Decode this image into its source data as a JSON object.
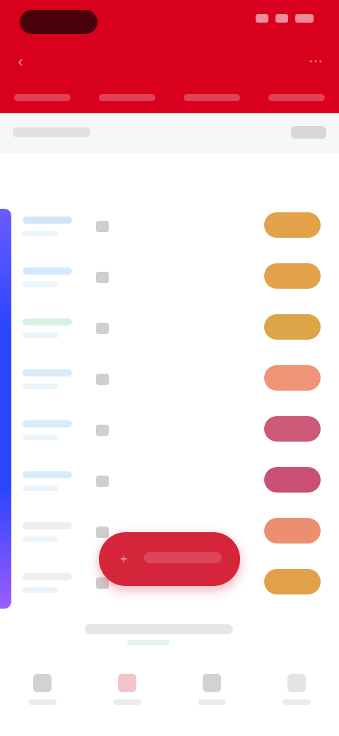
{
  "header": {
    "title": "",
    "back_icon": "chevron-left-icon",
    "more_icon": "more-icon",
    "tabs": [
      "",
      "",
      "",
      ""
    ]
  },
  "section": {
    "title": ""
  },
  "rows": [
    {
      "name_color": "#cfe6f7",
      "pill_color": "#e2a24a",
      "value": ""
    },
    {
      "name_color": "#d2e9ff",
      "pill_color": "#e2a24a",
      "value": ""
    },
    {
      "name_color": "#d7f0e3",
      "pill_color": "#dca548",
      "value": ""
    },
    {
      "name_color": "#d6ecfa",
      "pill_color": "#ee9478",
      "value": ""
    },
    {
      "name_color": "#d6ecfa",
      "pill_color": "#cc5a78",
      "value": ""
    },
    {
      "name_color": "#d6ecfa",
      "pill_color": "#c95074",
      "value": ""
    },
    {
      "name_color": "#eeeeee",
      "pill_color": "#ea8f6f",
      "value": ""
    },
    {
      "name_color": "#eeeeee",
      "pill_color": "#e2a04a",
      "value": ""
    }
  ],
  "fab": {
    "label": "",
    "icon": "plus-icon",
    "color": "#d5253a"
  },
  "colors": {
    "header": "#d9001e",
    "accent": "#d5253a"
  },
  "tabbar": [
    {
      "icon": "home-icon",
      "label": "",
      "color": "#d2d2d2"
    },
    {
      "icon": "list-icon",
      "label": "",
      "color": "#f3c3c8"
    },
    {
      "icon": "chart-icon",
      "label": "",
      "color": "#d2d2d2"
    },
    {
      "icon": "user-icon",
      "label": "",
      "color": "#e4e4e4"
    }
  ]
}
